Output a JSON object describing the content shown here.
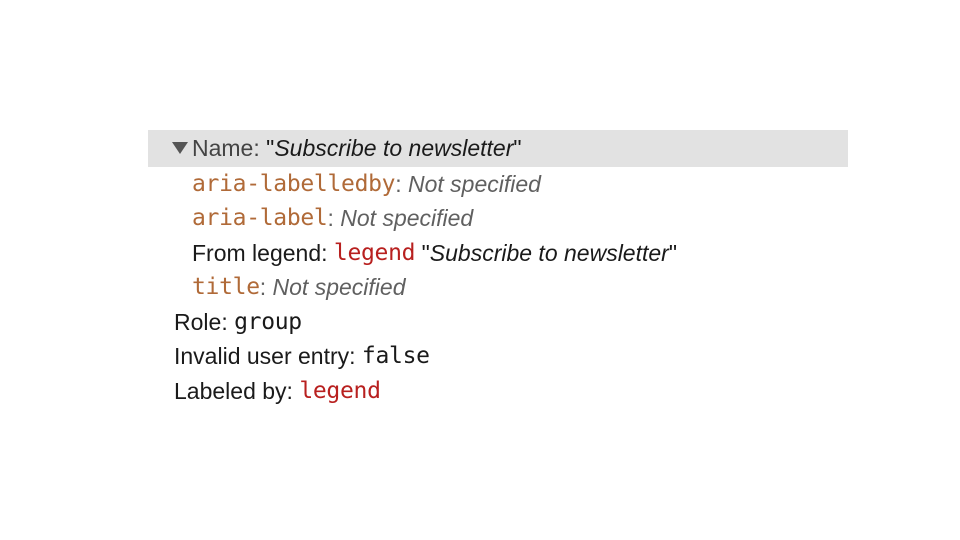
{
  "header": {
    "label": "Name",
    "value": "Subscribe to newsletter"
  },
  "sources": {
    "aria_labelledby": {
      "attr": "aria-labelledby",
      "value": "Not specified"
    },
    "aria_label": {
      "attr": "aria-label",
      "value": "Not specified"
    },
    "from_legend": {
      "label": "From legend",
      "tag": "legend",
      "value": "Subscribe to newsletter"
    },
    "title": {
      "attr": "title",
      "value": "Not specified"
    }
  },
  "role": {
    "label": "Role",
    "value": "group"
  },
  "invalid": {
    "label": "Invalid user entry",
    "value": "false"
  },
  "labeled_by": {
    "label": "Labeled by",
    "value": "legend"
  }
}
